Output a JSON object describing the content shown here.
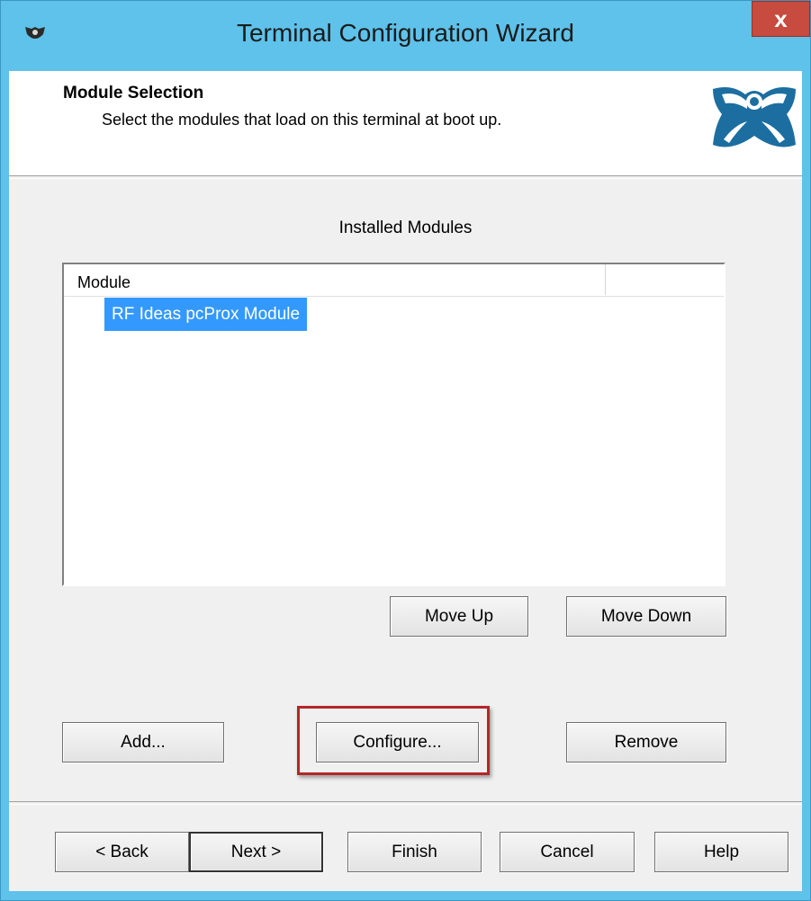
{
  "window": {
    "title": "Terminal Configuration Wizard",
    "close_label": "x"
  },
  "header": {
    "title": "Module Selection",
    "subtitle": "Select the modules that load on this terminal at boot up."
  },
  "modules": {
    "section_label": "Installed Modules",
    "columns": [
      "Module",
      ""
    ],
    "items": [
      {
        "name": "RF Ideas pcProx Module",
        "selected": true
      }
    ]
  },
  "order_buttons": {
    "move_up": "Move Up",
    "move_down": "Move Down"
  },
  "action_buttons": {
    "add": "Add...",
    "configure": "Configure...",
    "remove": "Remove"
  },
  "nav_buttons": {
    "back": "< Back",
    "next": "Next >",
    "finish": "Finish",
    "cancel": "Cancel",
    "help": "Help"
  },
  "colors": {
    "title_bar": "#5ec2ea",
    "close_button": "#c74b3e",
    "selection": "#3399ff",
    "annotation_highlight": "#b5252a",
    "logo": "#1c6ea0"
  },
  "icons": {
    "app": "thinmanager-icon",
    "brand": "thinmanager-logo"
  }
}
